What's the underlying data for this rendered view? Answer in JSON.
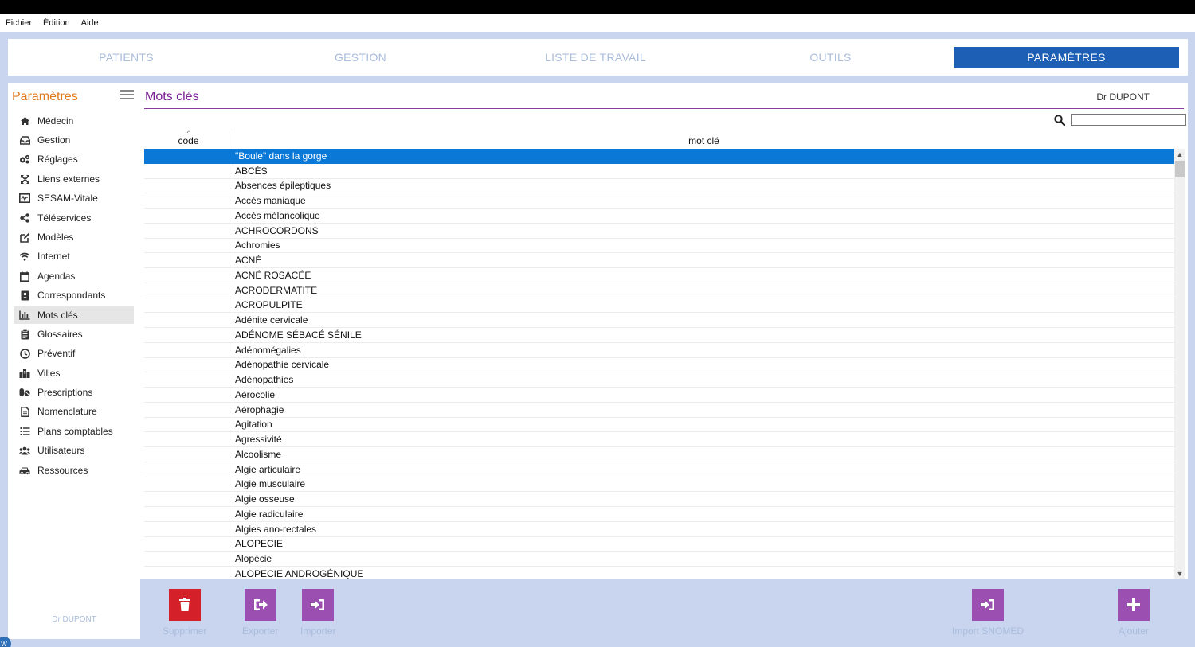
{
  "menu": [
    "Fichier",
    "Édition",
    "Aide"
  ],
  "tabs": [
    {
      "label": "PATIENTS",
      "active": false
    },
    {
      "label": "GESTION",
      "active": false
    },
    {
      "label": "LISTE DE TRAVAIL",
      "active": false
    },
    {
      "label": "OUTILS",
      "active": false
    },
    {
      "label": "PARAMÈTRES",
      "active": true
    }
  ],
  "sidebar": {
    "title": "Paramètres",
    "items": [
      {
        "label": "Médecin",
        "icon": "home-icon"
      },
      {
        "label": "Gestion",
        "icon": "inbox-icon"
      },
      {
        "label": "Réglages",
        "icon": "cogs-icon"
      },
      {
        "label": "Liens externes",
        "icon": "expand-arrows-icon"
      },
      {
        "label": "SESAM-Vitale",
        "icon": "card-reader-icon"
      },
      {
        "label": "Téléservices",
        "icon": "share-icon"
      },
      {
        "label": "Modèles",
        "icon": "edit-icon"
      },
      {
        "label": "Internet",
        "icon": "wifi-icon"
      },
      {
        "label": "Agendas",
        "icon": "calendar-icon"
      },
      {
        "label": "Correspondants",
        "icon": "contact-card-icon"
      },
      {
        "label": "Mots clés",
        "icon": "bar-chart-icon",
        "active": true
      },
      {
        "label": "Glossaires",
        "icon": "clipboard-icon"
      },
      {
        "label": "Préventif",
        "icon": "clock-icon"
      },
      {
        "label": "Villes",
        "icon": "buildings-icon"
      },
      {
        "label": "Prescriptions",
        "icon": "pills-icon"
      },
      {
        "label": "Nomenclature",
        "icon": "document-icon"
      },
      {
        "label": "Plans comptables",
        "icon": "list-icon"
      },
      {
        "label": "Utilisateurs",
        "icon": "users-icon"
      },
      {
        "label": "Ressources",
        "icon": "car-icon"
      }
    ],
    "footer": "Dr DUPONT"
  },
  "main": {
    "title": "Mots clés",
    "doctor": "Dr DUPONT",
    "search": {
      "value": "",
      "icon": "search-icon"
    },
    "columns": {
      "code": "code",
      "keyword": "mot clé"
    },
    "rows": [
      "\"Boule\" dans la gorge",
      "ABCÈS",
      "Absences épileptiques",
      "Accès maniaque",
      "Accès mélancolique",
      "ACHROCORDONS",
      "Achromies",
      "ACNÉ",
      "ACNÉ ROSACÉE",
      "ACRODERMATITE",
      "ACROPULPITE",
      "Adénite cervicale",
      "ADÉNOME SÉBACÉ SÉNILE",
      "Adénomégalies",
      "Adénopathie cervicale",
      "Adénopathies",
      "Aérocolie",
      "Aérophagie",
      "Agitation",
      "Agressivité",
      "Alcoolisme",
      "Algie articulaire",
      "Algie musculaire",
      "Algie osseuse",
      "Algie radiculaire",
      "Algies ano-rectales",
      "ALOPECIE",
      "Alopécie",
      "ALOPECIE ANDROGÉNIQUE"
    ],
    "selected_index": 0
  },
  "footer": {
    "delete": {
      "label": "Supprimer",
      "icon": "trash-icon",
      "color": "#d32029"
    },
    "export": {
      "label": "Exporter",
      "icon": "export-icon",
      "color": "#9b4fb0"
    },
    "import": {
      "label": "Importer",
      "icon": "import-icon",
      "color": "#9b4fb0"
    },
    "import_snomed": {
      "label": "Import SNOMED",
      "icon": "import-icon",
      "color": "#9b4fb0"
    },
    "add": {
      "label": "Ajouter",
      "icon": "plus-icon",
      "color": "#9b4fb0"
    }
  },
  "colors": {
    "accent": "#1d5fb5",
    "selection": "#0a78d7",
    "title": "#7b1f93",
    "sidebar_title": "#e07a1f"
  }
}
